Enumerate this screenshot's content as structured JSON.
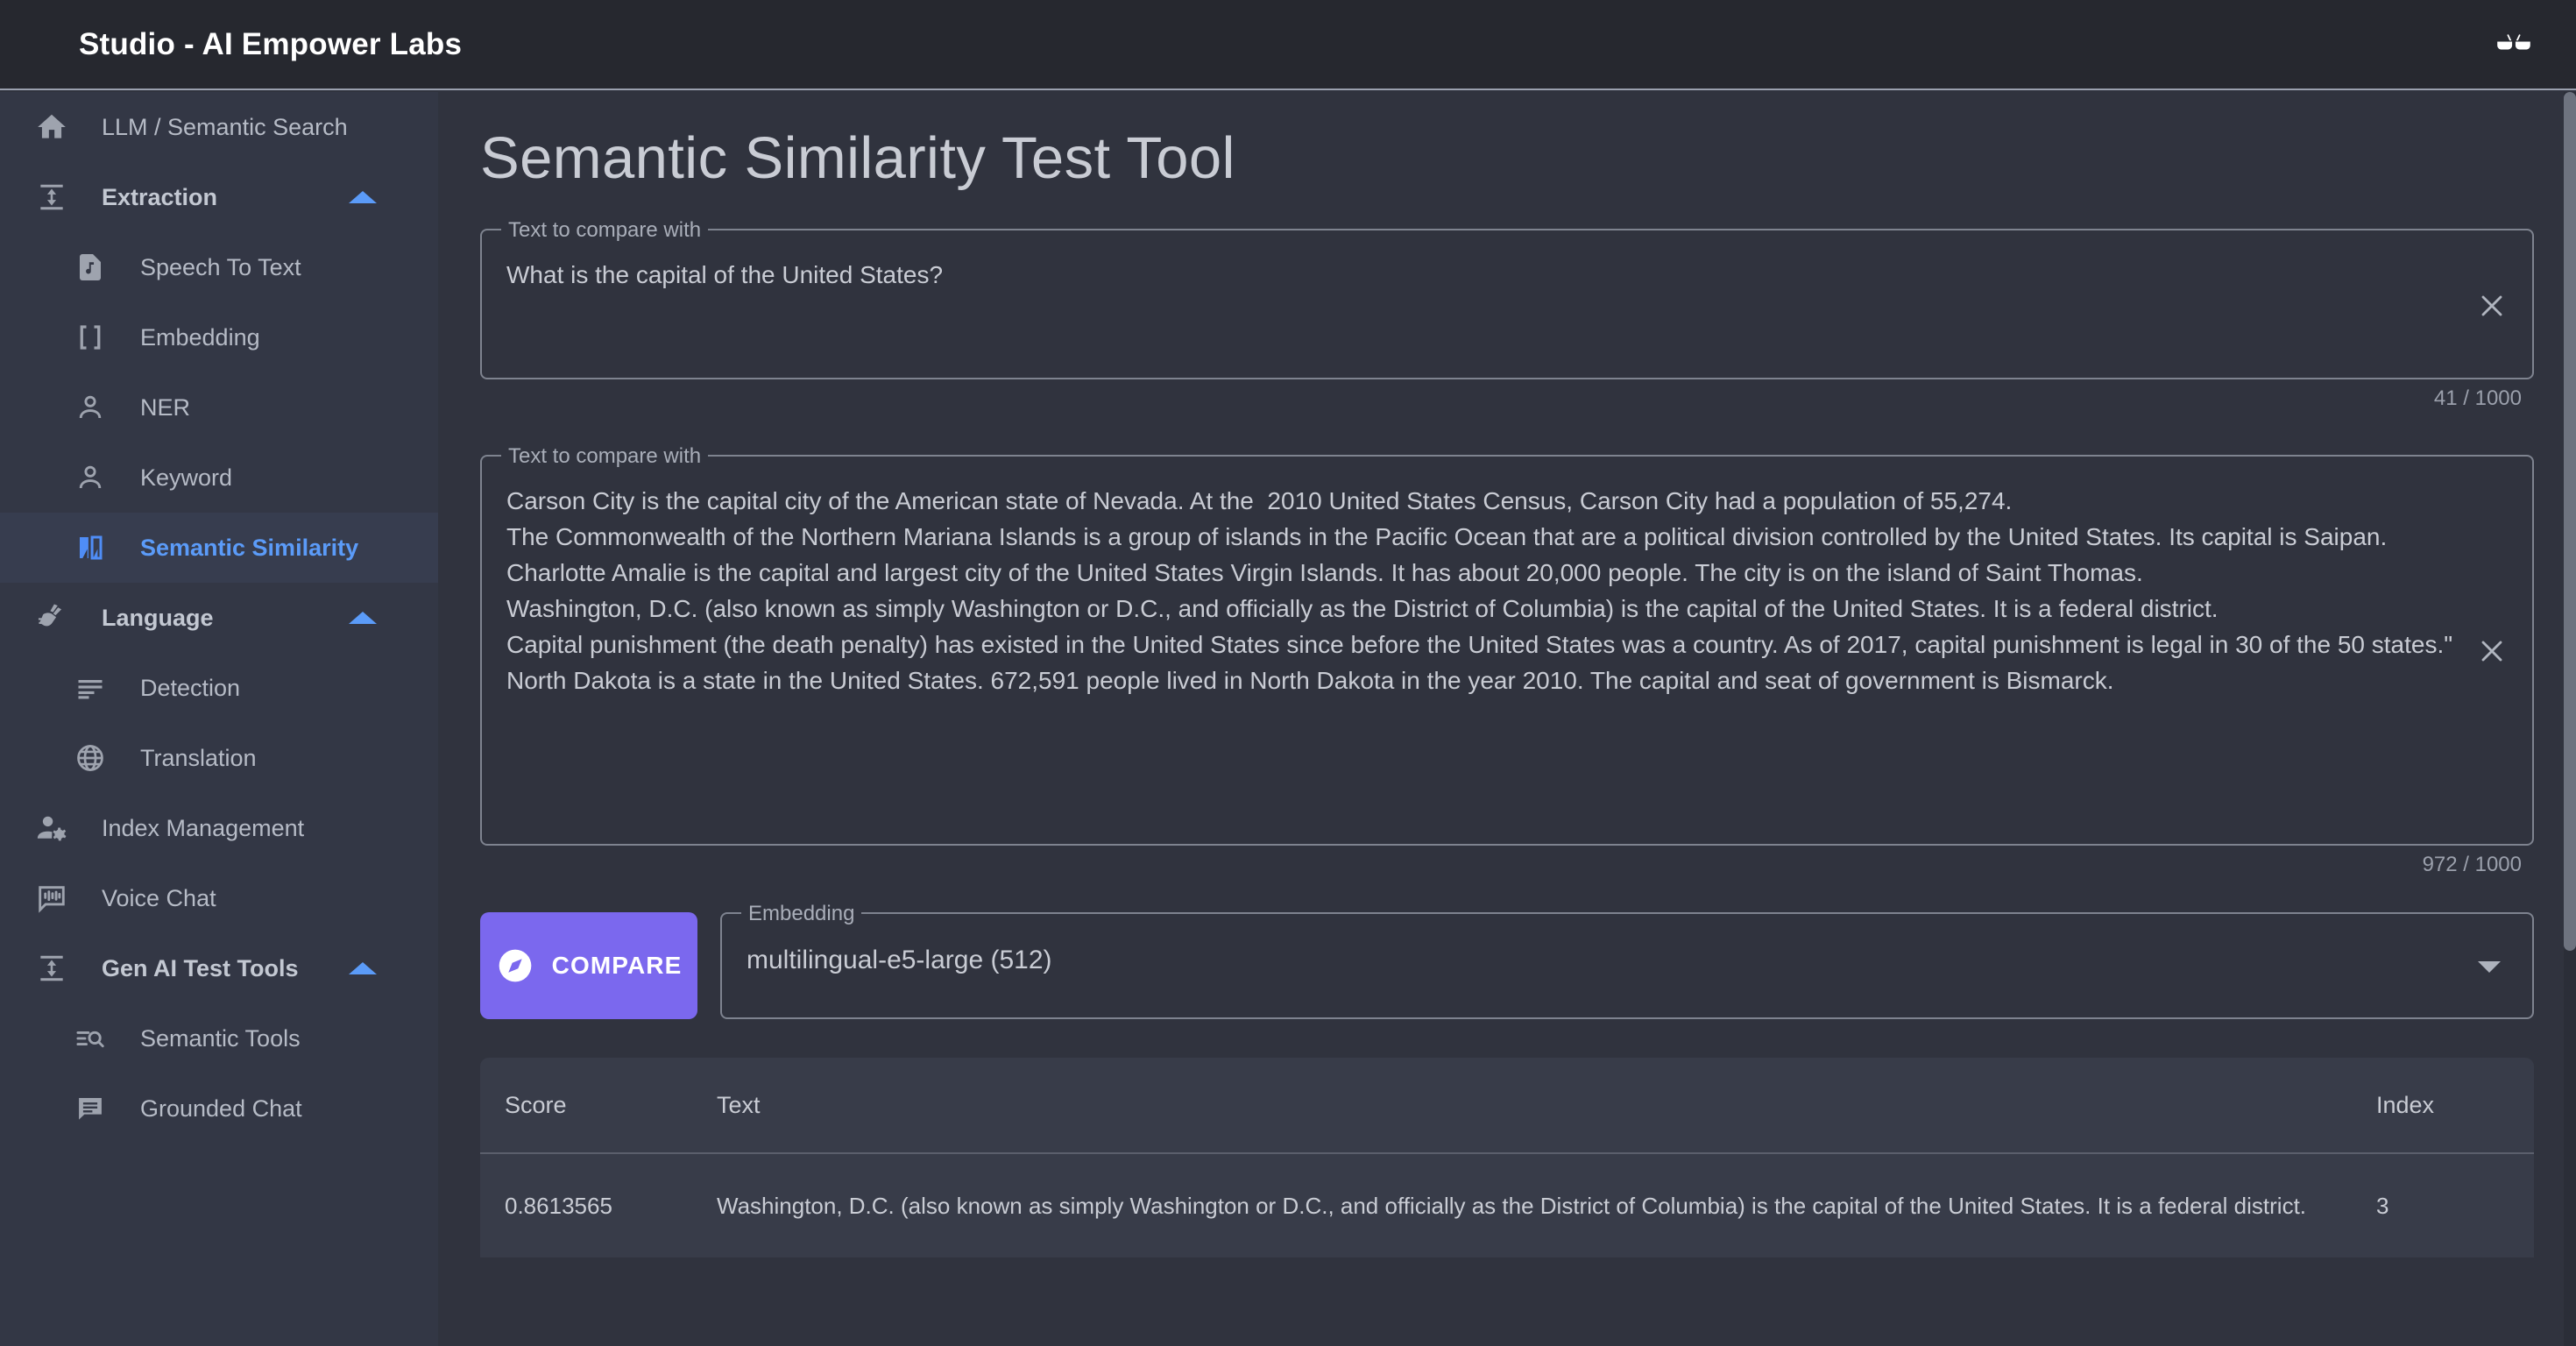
{
  "appbar": {
    "title": "Studio - AI Empower Labs",
    "action_icon": "glasses-icon"
  },
  "sidebar": {
    "items": [
      {
        "label": "LLM / Semantic Search",
        "icon": "home-icon",
        "level": "top",
        "selected": false,
        "expandable": false
      },
      {
        "label": "Extraction",
        "icon": "height-icon",
        "level": "group",
        "selected": false,
        "expandable": true
      },
      {
        "label": "Speech To Text",
        "icon": "audio-file-icon",
        "level": "child",
        "selected": false,
        "expandable": false
      },
      {
        "label": "Embedding",
        "icon": "brackets-icon",
        "level": "child",
        "selected": false,
        "expandable": false
      },
      {
        "label": "NER",
        "icon": "person-icon",
        "level": "child",
        "selected": false,
        "expandable": false
      },
      {
        "label": "Keyword",
        "icon": "person-icon",
        "level": "child",
        "selected": false,
        "expandable": false
      },
      {
        "label": "Semantic Similarity",
        "icon": "compare-pages-icon",
        "level": "child",
        "selected": true,
        "expandable": false
      },
      {
        "label": "Language",
        "icon": "sign-language-icon",
        "level": "group",
        "selected": false,
        "expandable": true
      },
      {
        "label": "Detection",
        "icon": "text-lines-icon",
        "level": "child",
        "selected": false,
        "expandable": false
      },
      {
        "label": "Translation",
        "icon": "globe-icon",
        "level": "child",
        "selected": false,
        "expandable": false
      },
      {
        "label": "Index Management",
        "icon": "manage-accounts-icon",
        "level": "top",
        "selected": false,
        "expandable": false
      },
      {
        "label": "Voice Chat",
        "icon": "voice-chat-icon",
        "level": "top",
        "selected": false,
        "expandable": false
      },
      {
        "label": "Gen AI Test Tools",
        "icon": "height-icon",
        "level": "group",
        "selected": false,
        "expandable": true
      },
      {
        "label": "Semantic Tools",
        "icon": "search-list-icon",
        "level": "child",
        "selected": false,
        "expandable": false
      },
      {
        "label": "Grounded Chat",
        "icon": "chat-icon",
        "level": "child",
        "selected": false,
        "expandable": false
      }
    ]
  },
  "main": {
    "page_title": "Semantic Similarity Test Tool",
    "field_query": {
      "legend": "Text to compare with",
      "value": "What is the capital of the United States?",
      "counter": "41 / 1000",
      "clear_icon": "close-icon"
    },
    "field_corpus": {
      "legend": "Text to compare with",
      "value": "Carson City is the capital city of the American state of Nevada. At the  2010 United States Census, Carson City had a population of 55,274.\nThe Commonwealth of the Northern Mariana Islands is a group of islands in the Pacific Ocean that are a political division controlled by the United States. Its capital is Saipan.\nCharlotte Amalie is the capital and largest city of the United States Virgin Islands. It has about 20,000 people. The city is on the island of Saint Thomas.\nWashington, D.C. (also known as simply Washington or D.C., and officially as the District of Columbia) is the capital of the United States. It is a federal district.\nCapital punishment (the death penalty) has existed in the United States since before the United States was a country. As of 2017, capital punishment is legal in 30 of the 50 states.\"\nNorth Dakota is a state in the United States. 672,591 people lived in North Dakota in the year 2010. The capital and seat of government is Bismarck.",
      "counter": "972 / 1000",
      "clear_icon": "close-icon"
    },
    "compare_button": {
      "label": "COMPARE",
      "icon": "explore-icon"
    },
    "embedding_select": {
      "legend": "Embedding",
      "value": "multilingual-e5-large (512)",
      "caret_icon": "chevron-down-icon"
    },
    "results_table": {
      "columns": [
        "Score",
        "Text",
        "Index"
      ],
      "rows": [
        {
          "score": "0.8613565",
          "text": "Washington, D.C. (also known as simply Washington or D.C., and officially as the District of Columbia) is the capital of the United States. It is a federal district.",
          "index": "3"
        }
      ]
    }
  },
  "colors": {
    "appbar_bg": "#26282f",
    "sidebar_bg": "#333745",
    "main_bg": "#30333e",
    "accent_blue": "#5b9bf8",
    "accent_purple": "#7b68ee",
    "table_bg": "#383c49",
    "text_primary": "#c9ccd4",
    "text_muted": "#9ba0ac"
  }
}
